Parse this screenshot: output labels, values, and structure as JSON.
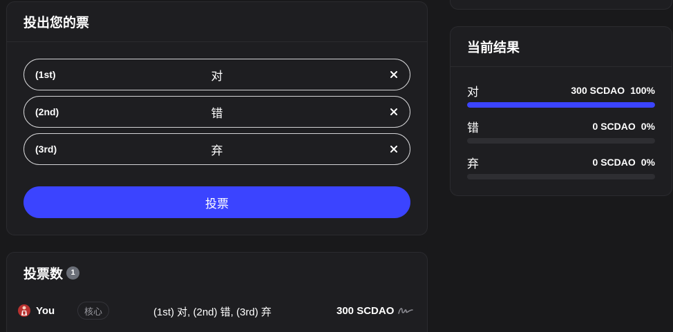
{
  "cast_vote": {
    "title": "投出您的票",
    "choices": [
      {
        "rank": "(1st)",
        "label": "对"
      },
      {
        "rank": "(2nd)",
        "label": "错"
      },
      {
        "rank": "(3rd)",
        "label": "弃"
      }
    ],
    "vote_button": "投票"
  },
  "results": {
    "title": "当前结果",
    "items": [
      {
        "label": "对",
        "amount": "300 SCDAO",
        "percent": "100%",
        "fill": 100
      },
      {
        "label": "错",
        "amount": "0 SCDAO",
        "percent": "0%",
        "fill": 0
      },
      {
        "label": "弃",
        "amount": "0 SCDAO",
        "percent": "0%",
        "fill": 0
      }
    ]
  },
  "votes": {
    "title": "投票数",
    "count": "1",
    "rows": [
      {
        "voter": "You",
        "role": "核心",
        "choices": "(1st) 对, (2nd) 错, (3rd) 弃",
        "amount": "300 SCDAO"
      }
    ]
  },
  "colors": {
    "accent": "#3b44ff",
    "background": "#19191b",
    "card": "#1e1e21"
  }
}
